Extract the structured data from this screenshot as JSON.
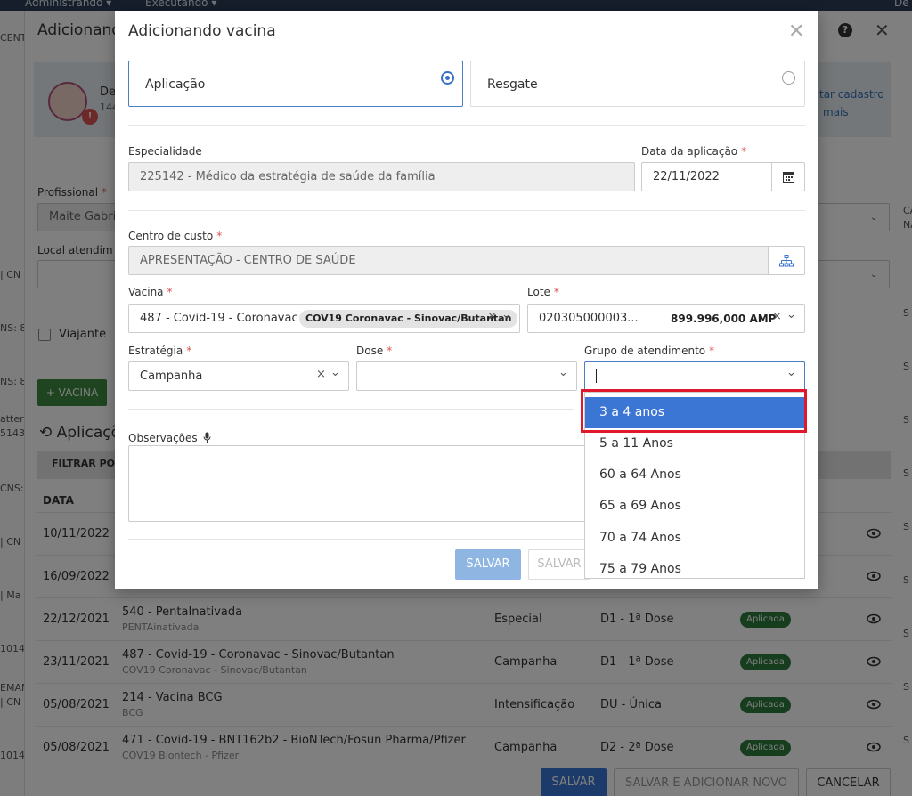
{
  "topbar": {
    "menu1": "Administrando ▾",
    "menu2": "Executando ▾",
    "right": "De"
  },
  "background": {
    "title": "Adicionand",
    "help_icon": "question-circle-icon",
    "patient": {
      "name": "De",
      "sub": "144",
      "link1": "tar cadastro",
      "link2": "mais"
    },
    "profissional_label": "Profissional",
    "profissional_value": "Maite Gabrie",
    "local_label": "Local atendim",
    "viajante_label": "Viajante",
    "add_vacina_label": "+ VACINA",
    "aplicacoes_title": "Aplicaçõ",
    "filter_label": "FILTRAR POR",
    "col_data": "DATA",
    "left_strip": [
      "CENT",
      "| CN",
      "NS: 86",
      "NS: 86",
      "atter",
      "5143",
      "CNS:",
      "| CN",
      "| Ma",
      "1014",
      "EMAN",
      "| CN",
      "1014"
    ],
    "right_strip": [
      "CA",
      "NA",
      "S",
      "S",
      "S",
      "S",
      "S",
      "S",
      "S",
      "S",
      "S"
    ],
    "rows": [
      {
        "date": "10/11/2022",
        "vac": "",
        "vac2": "",
        "est": "",
        "dose": "",
        "badge": ""
      },
      {
        "date": "16/09/2022",
        "vac": "",
        "vac2": "",
        "est": "",
        "dose": "",
        "badge": ""
      },
      {
        "date": "22/12/2021",
        "vac": "540 - PentaInativada",
        "vac2": "PENTAinativada",
        "est": "Especial",
        "dose": "D1 - 1ª Dose",
        "badge": "Aplicada"
      },
      {
        "date": "23/11/2021",
        "vac": "487 - Covid-19 - Coronavac - Sinovac/Butantan",
        "vac2": "COV19 Coronavac - Sinovac/Butantan",
        "est": "Campanha",
        "dose": "D1 - 1ª Dose",
        "badge": "Aplicada"
      },
      {
        "date": "05/08/2021",
        "vac": "214 - Vacina BCG",
        "vac2": "BCG",
        "est": "Intensificação",
        "dose": "DU - Única",
        "badge": "Aplicada"
      },
      {
        "date": "05/08/2021",
        "vac": "471 - Covid-19 - BNT162b2 - BioNTech/Fosun Pharma/Pfizer",
        "vac2": "COV19 Biontech - Pfizer",
        "est": "Campanha",
        "dose": "D2 - 2ª Dose",
        "badge": "Aplicada"
      }
    ],
    "footer": {
      "salvar": "SALVAR",
      "salvar_novo": "SALVAR E ADICIONAR NOVO",
      "cancelar": "CANCELAR"
    }
  },
  "modal": {
    "title": "Adicionando vacina",
    "close_icon": "close-icon",
    "tabs": [
      {
        "label": "Aplicação",
        "selected": true
      },
      {
        "label": "Resgate",
        "selected": false
      }
    ],
    "especialidade_label": "Especialidade",
    "especialidade_value": "225142 - Médico da estratégia de saúde da família",
    "data_label": "Data da aplicação",
    "data_value": "22/11/2022",
    "centro_label": "Centro de custo",
    "centro_value": "APRESENTAÇÃO - CENTRO DE SAÚDE",
    "vacina_label": "Vacina",
    "vacina_value": "487 - Covid-19 - Coronavac -",
    "vacina_chip": "COV19 Coronavac - Sinovac/Butantan",
    "lote_label": "Lote",
    "lote_value": "020305000003...",
    "lote_amount": "899.996,000 AMP",
    "estrategia_label": "Estratégia",
    "estrategia_value": "Campanha",
    "dose_label": "Dose",
    "dose_value": "",
    "grupo_label": "Grupo de atendimento",
    "grupo_value": "",
    "observacoes_label": "Observações",
    "salvar_label": "SALVAR",
    "salvar2_label": "SALVAR"
  },
  "dropdown": {
    "options": [
      "3 a 4 anos",
      "5 a 11 Anos",
      "60 a 64 Anos",
      "65 a 69 Anos",
      "70 a 74 Anos",
      "75 a 79 Anos"
    ],
    "selected_index": 0
  },
  "colors": {
    "primary": "#3b76d4",
    "highlight_border": "#e0182d",
    "success": "#2d7b3a",
    "required": "#d9534f"
  }
}
